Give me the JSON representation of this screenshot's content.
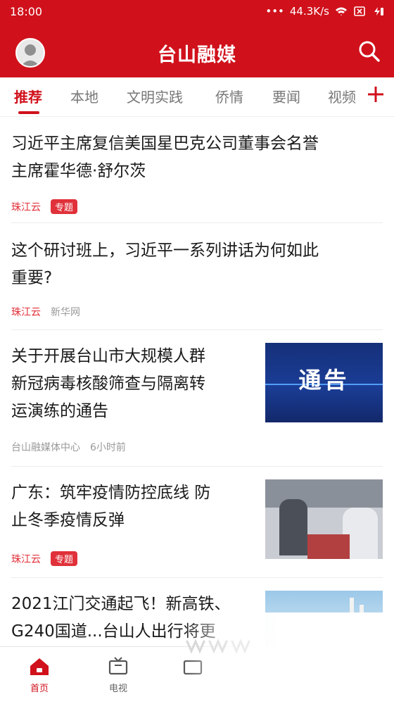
{
  "status_bar": {
    "time": "18:00",
    "network_speed": "44.3K/s",
    "icons": [
      "dots-icon",
      "wifi-icon",
      "sim-icon",
      "battery-charging-icon"
    ]
  },
  "header": {
    "title": "台山融媒",
    "avatar_icon": "user-avatar-icon",
    "search_icon": "search-icon",
    "color": "#d0111b"
  },
  "tabs": {
    "items": [
      {
        "label": "推荐",
        "active": true
      },
      {
        "label": "本地"
      },
      {
        "label": "文明实践"
      },
      {
        "label": "侨情"
      },
      {
        "label": "要闻"
      },
      {
        "label": "视频"
      }
    ],
    "add_icon": "plus-icon"
  },
  "feed": [
    {
      "title_lines": [
        "习近平主席复信美国星巴克公司董事会名誉",
        "主席霍华德·舒尔茨"
      ],
      "source": "珠江云",
      "badge": "专题"
    },
    {
      "title_lines": [
        "这个研讨班上，习近平一系列讲话为何如此",
        "重要?"
      ],
      "source": "珠江云",
      "secondary_source": "新华网"
    },
    {
      "title_lines": [
        "关于开展台山市大规模人群",
        "新冠病毒核酸筛查与隔离转",
        "运演练的通告"
      ],
      "source": "台山融媒体中心",
      "time": "6小时前",
      "thumb_text": "通告"
    },
    {
      "title_lines": [
        "广东：筑牢疫情防控底线 防",
        "止冬季疫情反弹"
      ],
      "source": "珠江云",
      "badge": "专题"
    },
    {
      "title_lines": [
        "2021江门交通起飞！新高铁、",
        "G240国道...台山人出行将更"
      ]
    }
  ],
  "bottom_nav": [
    {
      "label": "首页",
      "icon": "home-icon",
      "active": true
    },
    {
      "label": "电视",
      "icon": "tv-icon"
    },
    {
      "label": "",
      "icon": "radio-icon"
    }
  ]
}
